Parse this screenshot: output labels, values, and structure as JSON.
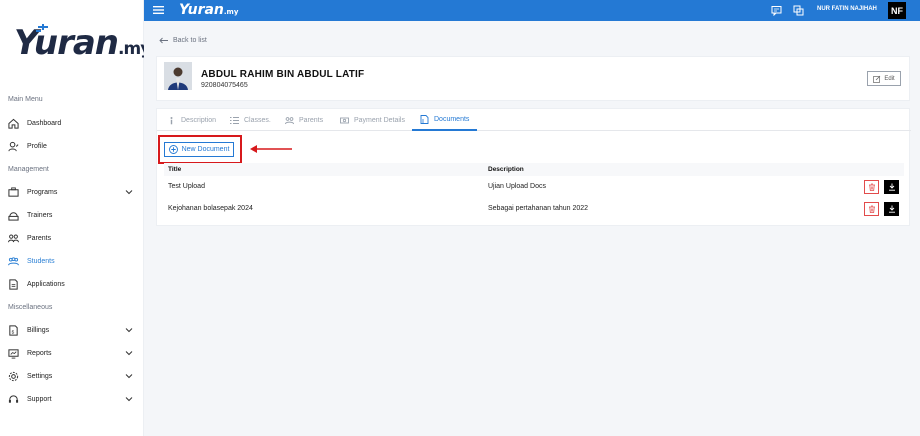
{
  "brand": {
    "logo_text": "Yuran",
    "logo_suffix": ".my",
    "accent": "#2479d4"
  },
  "topbar": {
    "user_name": "NUR FATIN NAJIHAH",
    "user_initials": "NF",
    "icons": [
      "menu-icon",
      "chat-icon",
      "switch-icon"
    ]
  },
  "sidebar": {
    "sections": [
      {
        "label": "Main Menu",
        "items": [
          {
            "label": "Dashboard",
            "icon": "home-icon",
            "expandable": false,
            "active": false
          },
          {
            "label": "Profile",
            "icon": "user-icon",
            "expandable": false,
            "active": false
          }
        ]
      },
      {
        "label": "Management",
        "items": [
          {
            "label": "Programs",
            "icon": "programs-icon",
            "expandable": true,
            "active": false
          },
          {
            "label": "Trainers",
            "icon": "trainer-icon",
            "expandable": false,
            "active": false
          },
          {
            "label": "Parents",
            "icon": "parents-icon",
            "expandable": false,
            "active": false
          },
          {
            "label": "Students",
            "icon": "students-icon",
            "expandable": false,
            "active": true
          },
          {
            "label": "Applications",
            "icon": "document-icon",
            "expandable": false,
            "active": false
          }
        ]
      },
      {
        "label": "Miscellaneous",
        "items": [
          {
            "label": "Billings",
            "icon": "billing-icon",
            "expandable": true,
            "active": false
          },
          {
            "label": "Reports",
            "icon": "report-icon",
            "expandable": true,
            "active": false
          },
          {
            "label": "Settings",
            "icon": "gear-icon",
            "expandable": true,
            "active": false
          },
          {
            "label": "Support",
            "icon": "headset-icon",
            "expandable": true,
            "active": false
          }
        ]
      }
    ]
  },
  "main": {
    "back_label": "Back to list",
    "student": {
      "name": "ABDUL RAHIM BIN ABDUL LATIF",
      "id": "920804075465"
    },
    "edit_label": "Edit",
    "tabs": [
      {
        "label": "Description",
        "icon": "info-icon",
        "active": false
      },
      {
        "label": "Classes.",
        "icon": "list-icon",
        "active": false
      },
      {
        "label": "Parents",
        "icon": "parents-icon",
        "active": false
      },
      {
        "label": "Payment Details",
        "icon": "payment-icon",
        "active": false
      },
      {
        "label": "Documents",
        "icon": "documents-icon",
        "active": true
      }
    ],
    "new_document_label": "New Document",
    "table": {
      "headers": [
        "Title",
        "Description"
      ],
      "rows": [
        {
          "title": "Test Upload",
          "description": "Ujian Upload Docs"
        },
        {
          "title": "Kejohanan bolasepak 2024",
          "description": "Sebagai pertahanan tahun 2022"
        }
      ]
    }
  }
}
